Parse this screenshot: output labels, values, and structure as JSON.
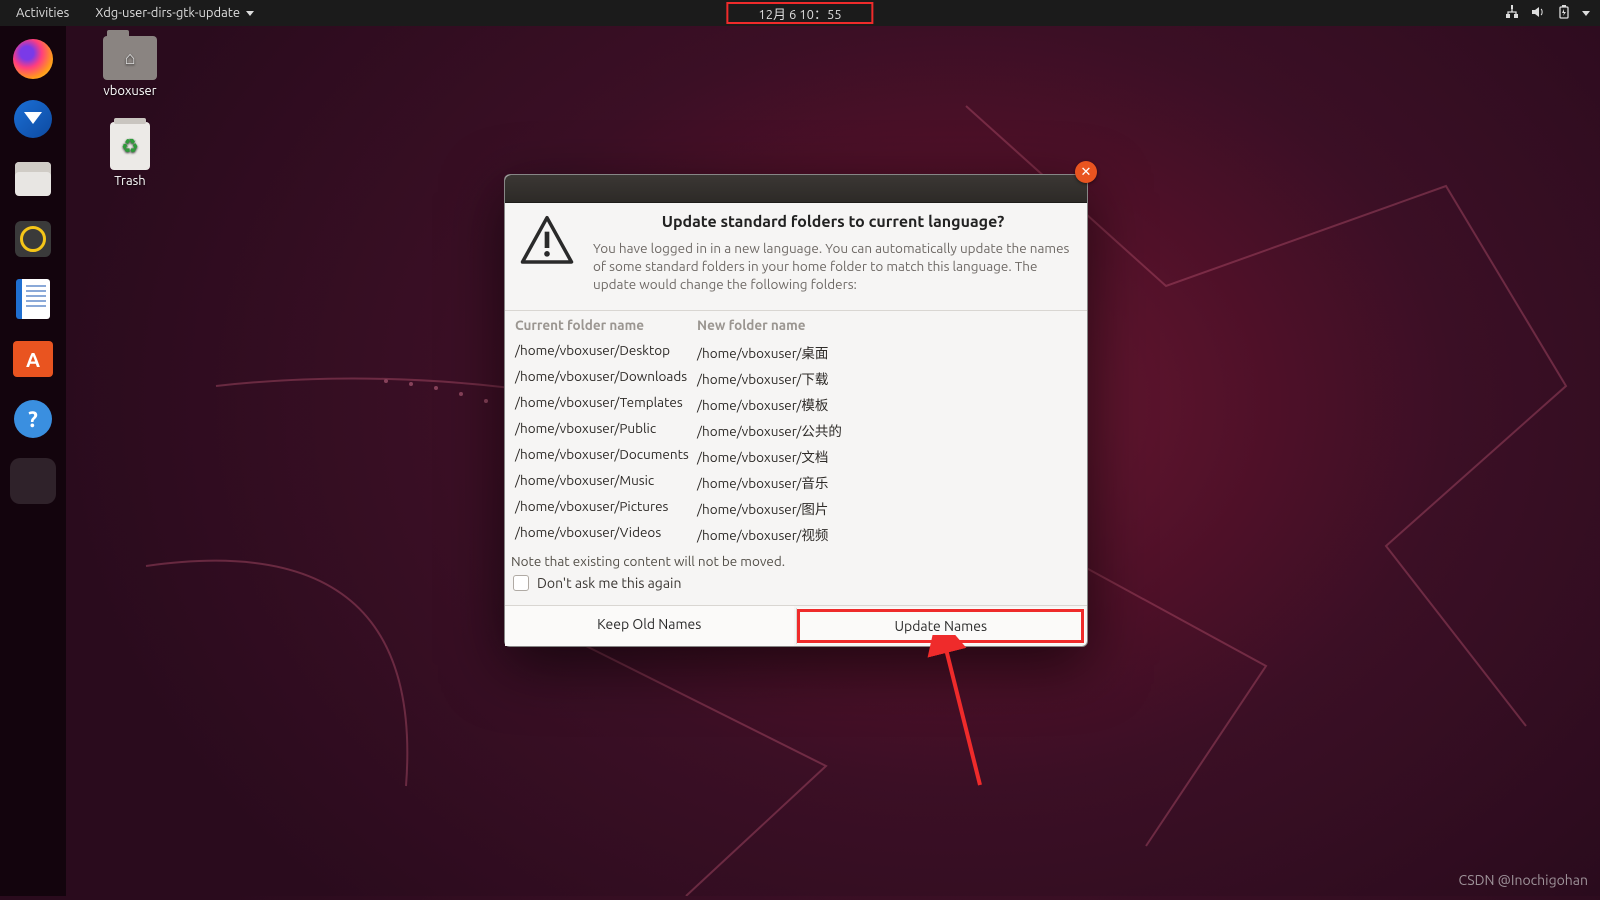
{
  "topbar": {
    "activities": "Activities",
    "app_menu": "Xdg-user-dirs-gtk-update",
    "clock": "12月 6 10：55"
  },
  "dock": {
    "items": [
      {
        "name": "firefox",
        "label": "Firefox"
      },
      {
        "name": "thunderbird",
        "label": "Thunderbird"
      },
      {
        "name": "files",
        "label": "Files"
      },
      {
        "name": "rhythmbox",
        "label": "Rhythmbox"
      },
      {
        "name": "writer",
        "label": "LibreOffice Writer"
      },
      {
        "name": "software",
        "label": "Ubuntu Software"
      },
      {
        "name": "help",
        "label": "Help"
      }
    ]
  },
  "desktop": {
    "home_label": "vboxuser",
    "trash_label": "Trash"
  },
  "dialog": {
    "title": "Update standard folders to current language?",
    "body": "You have logged in in a new language. You can automatically update the names of some standard folders in your home folder to match this language. The update would change the following folders:",
    "col_current": "Current folder name",
    "col_new": "New folder name",
    "rows": [
      {
        "cur": "/home/vboxuser/Desktop",
        "new": "/home/vboxuser/桌面"
      },
      {
        "cur": "/home/vboxuser/Downloads",
        "new": "/home/vboxuser/下载"
      },
      {
        "cur": "/home/vboxuser/Templates",
        "new": "/home/vboxuser/模板"
      },
      {
        "cur": "/home/vboxuser/Public",
        "new": "/home/vboxuser/公共的"
      },
      {
        "cur": "/home/vboxuser/Documents",
        "new": "/home/vboxuser/文档"
      },
      {
        "cur": "/home/vboxuser/Music",
        "new": "/home/vboxuser/音乐"
      },
      {
        "cur": "/home/vboxuser/Pictures",
        "new": "/home/vboxuser/图片"
      },
      {
        "cur": "/home/vboxuser/Videos",
        "new": "/home/vboxuser/视频"
      }
    ],
    "note": "Note that existing content will not be moved.",
    "checkbox": "Don't ask me this again",
    "btn_keep": "Keep Old Names",
    "btn_update": "Update Names"
  },
  "watermark": "CSDN @Inochigohan"
}
